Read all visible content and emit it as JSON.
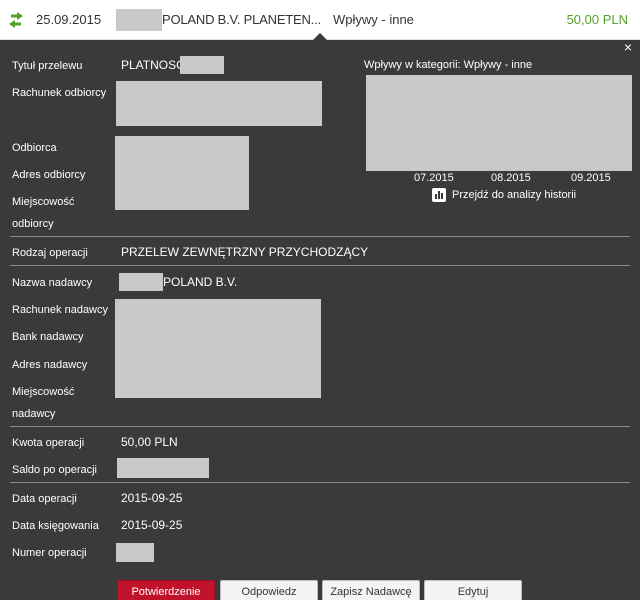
{
  "header": {
    "date": "25.09.2015",
    "title": "POLAND B.V. PLANETEN...",
    "category": "Wpływy - inne",
    "amount": "50,00 PLN"
  },
  "close_label": "×",
  "fields": {
    "tytul_label": "Tytuł przelewu",
    "tytul_value": "PLATNOSC",
    "rachunek_odbiorcy_label": "Rachunek odbiorcy",
    "odbiorca_label": "Odbiorca",
    "adres_odbiorcy_label": "Adres odbiorcy",
    "miejscowosc_odbiorcy_label_1": "Miejscowość",
    "miejscowosc_odbiorcy_label_2": "odbiorcy",
    "rodzaj_label": "Rodzaj operacji",
    "rodzaj_value": "PRZELEW ZEWNĘTRZNY PRZYCHODZĄCY",
    "nazwa_nadawcy_label": "Nazwa nadawcy",
    "nazwa_nadawcy_value": "POLAND B.V.",
    "rachunek_nadawcy_label": "Rachunek nadawcy",
    "bank_nadawcy_label": "Bank nadawcy",
    "adres_nadawcy_label": "Adres nadawcy",
    "miejscowosc_nadawcy_label_1": "Miejscowość",
    "miejscowosc_nadawcy_label_2": "nadawcy",
    "kwota_label": "Kwota operacji",
    "kwota_value": "50,00 PLN",
    "saldo_label": "Saldo po operacji",
    "data_operacji_label": "Data operacji",
    "data_operacji_value": "2015-09-25",
    "data_ksiegowania_label": "Data księgowania",
    "data_ksiegowania_value": "2015-09-25",
    "numer_label": "Numer operacji"
  },
  "chart": {
    "title": "Wpływy w kategorii:",
    "category": "Wpływy - inne",
    "ticks": [
      "07.2015",
      "08.2015",
      "09.2015"
    ],
    "history_link": "Przejdź do analizy historii"
  },
  "buttons": {
    "potwierdzenie": "Potwierdzenie",
    "odpowiedz": "Odpowiedz",
    "zapisz": "Zapisz Nadawcę",
    "edytuj": "Edytuj"
  },
  "colors": {
    "panel_bg": "#3a3a3a",
    "amount_green": "#55a026",
    "primary_red": "#c0122a",
    "mask_gray": "#c8c8c8"
  }
}
